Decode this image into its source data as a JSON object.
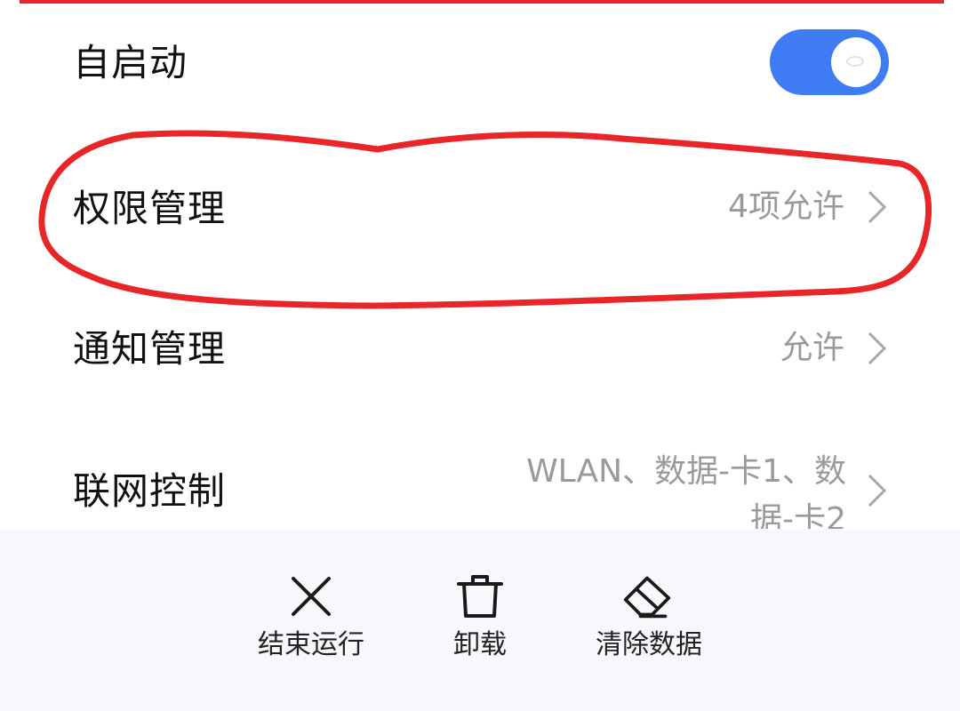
{
  "settings": {
    "autostart": {
      "label": "自启动",
      "enabled": true
    },
    "permission": {
      "label": "权限管理",
      "value": "4项允许"
    },
    "notification": {
      "label": "通知管理",
      "value": "允许"
    },
    "network": {
      "label": "联网控制",
      "value_line1": "WLAN、数据-卡1、数",
      "value_line2": "据-卡2"
    }
  },
  "actions": {
    "stop_label": "结束运行",
    "uninstall_label": "卸载",
    "clear_label": "清除数据"
  },
  "colors": {
    "accent": "#3f7cf4",
    "annotation": "#e8262a",
    "secondary_text": "#9a9a9a",
    "bottom_bar": "#f6f8fb"
  },
  "icons": {
    "chevron": "chevron-right-icon",
    "stop": "close-icon",
    "uninstall": "trash-icon",
    "clear": "eraser-icon"
  }
}
